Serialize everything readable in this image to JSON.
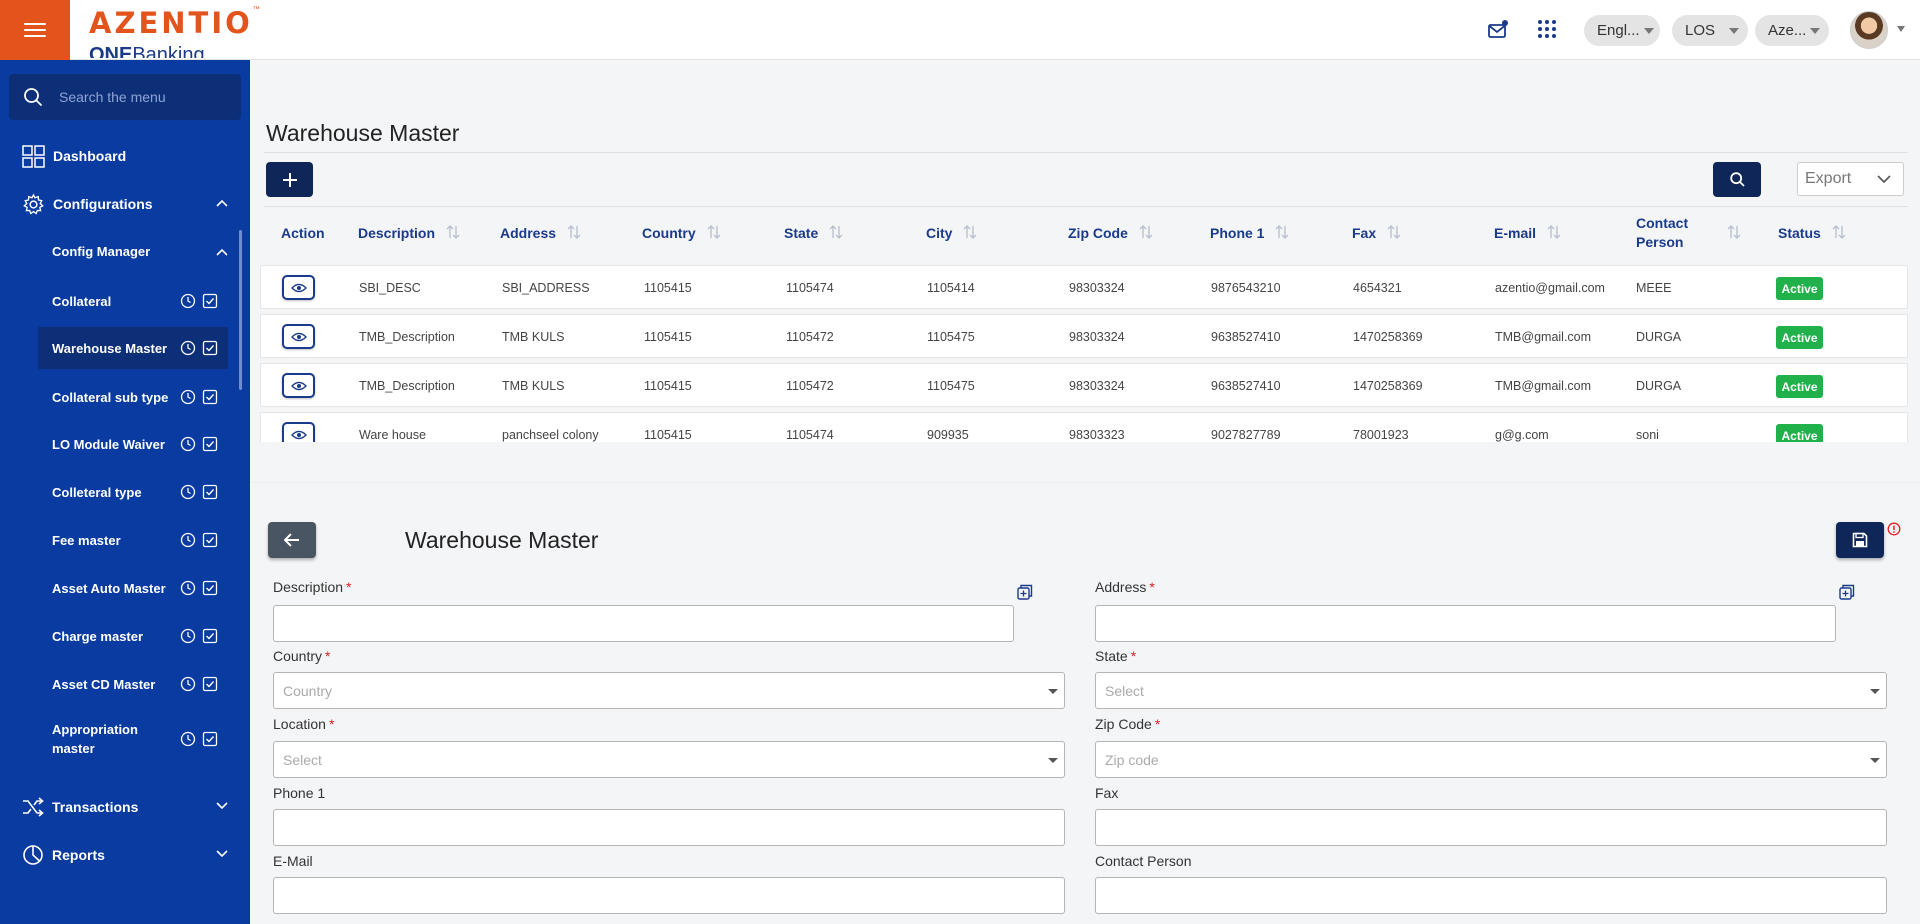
{
  "header": {
    "brand_name": "AZENTIO",
    "brand_tm": "™",
    "brand_sub_bold": "ONE",
    "brand_sub_light": "Banking",
    "language": "Engl...",
    "module": "LOS",
    "tenant": "Aze...",
    "icons": [
      "hamburger-icon",
      "mail-icon",
      "apps-grid-icon",
      "avatar"
    ]
  },
  "sidebar": {
    "search_placeholder": "Search the menu",
    "dashboard": "Dashboard",
    "configurations": "Configurations",
    "config_manager": "Config Manager",
    "items": [
      {
        "label": "Collateral"
      },
      {
        "label": "Warehouse Master"
      },
      {
        "label": "Collateral sub type"
      },
      {
        "label": "LO Module Waiver"
      },
      {
        "label": "Colleteral type"
      },
      {
        "label": "Fee master"
      },
      {
        "label": "Asset Auto Master"
      },
      {
        "label": "Charge master"
      },
      {
        "label": "Asset CD Master"
      },
      {
        "label": "Appropriation master"
      }
    ],
    "active_item": "Warehouse Master",
    "transactions": "Transactions",
    "reports": "Reports"
  },
  "list": {
    "title": "Warehouse Master",
    "export_label": "Export",
    "columns": [
      "Action",
      "Description",
      "Address",
      "Country",
      "State",
      "City",
      "Zip Code",
      "Phone 1",
      "Fax",
      "E-mail",
      "Contact Person",
      "Status"
    ],
    "rows": [
      {
        "description": "SBI_DESC",
        "address": "SBI_ADDRESS",
        "country": "1105415",
        "state": "1105474",
        "city": "1105414",
        "zip": "98303324",
        "phone": "9876543210",
        "fax": "4654321",
        "email": "azentio@gmail.com",
        "contact": "MEEE",
        "status": "Active"
      },
      {
        "description": "TMB_Description",
        "address": "TMB KULS",
        "country": "1105415",
        "state": "1105472",
        "city": "1105475",
        "zip": "98303324",
        "phone": "9638527410",
        "fax": "1470258369",
        "email": "TMB@gmail.com",
        "contact": "DURGA",
        "status": "Active"
      },
      {
        "description": "TMB_Description",
        "address": "TMB KULS",
        "country": "1105415",
        "state": "1105472",
        "city": "1105475",
        "zip": "98303324",
        "phone": "9638527410",
        "fax": "1470258369",
        "email": "TMB@gmail.com",
        "contact": "DURGA",
        "status": "Active"
      },
      {
        "description": "Ware house",
        "address": "panchseel colony",
        "country": "1105415",
        "state": "1105474",
        "city": "909935",
        "zip": "98303323",
        "phone": "9027827789",
        "fax": "78001923",
        "email": "g@g.com",
        "contact": "soni",
        "status": "Active"
      }
    ]
  },
  "form": {
    "title": "Warehouse Master",
    "description_label": "Description",
    "address_label": "Address",
    "country_label": "Country",
    "country_placeholder": "Country",
    "state_label": "State",
    "state_placeholder": "Select",
    "location_label": "Location",
    "location_placeholder": "Select",
    "zip_label": "Zip Code",
    "zip_placeholder": "Zip code",
    "phone1_label": "Phone 1",
    "fax_label": "Fax",
    "email_label": "E-Mail",
    "contact_label": "Contact Person",
    "required_mark": "*"
  },
  "colors": {
    "brand_orange": "#e2541b",
    "sidebar_blue": "#0a3ba1",
    "primary_navy": "#0e2658",
    "header_text_blue": "#1a3a8a",
    "status_green": "#21b14a",
    "required_red": "#e02020"
  }
}
